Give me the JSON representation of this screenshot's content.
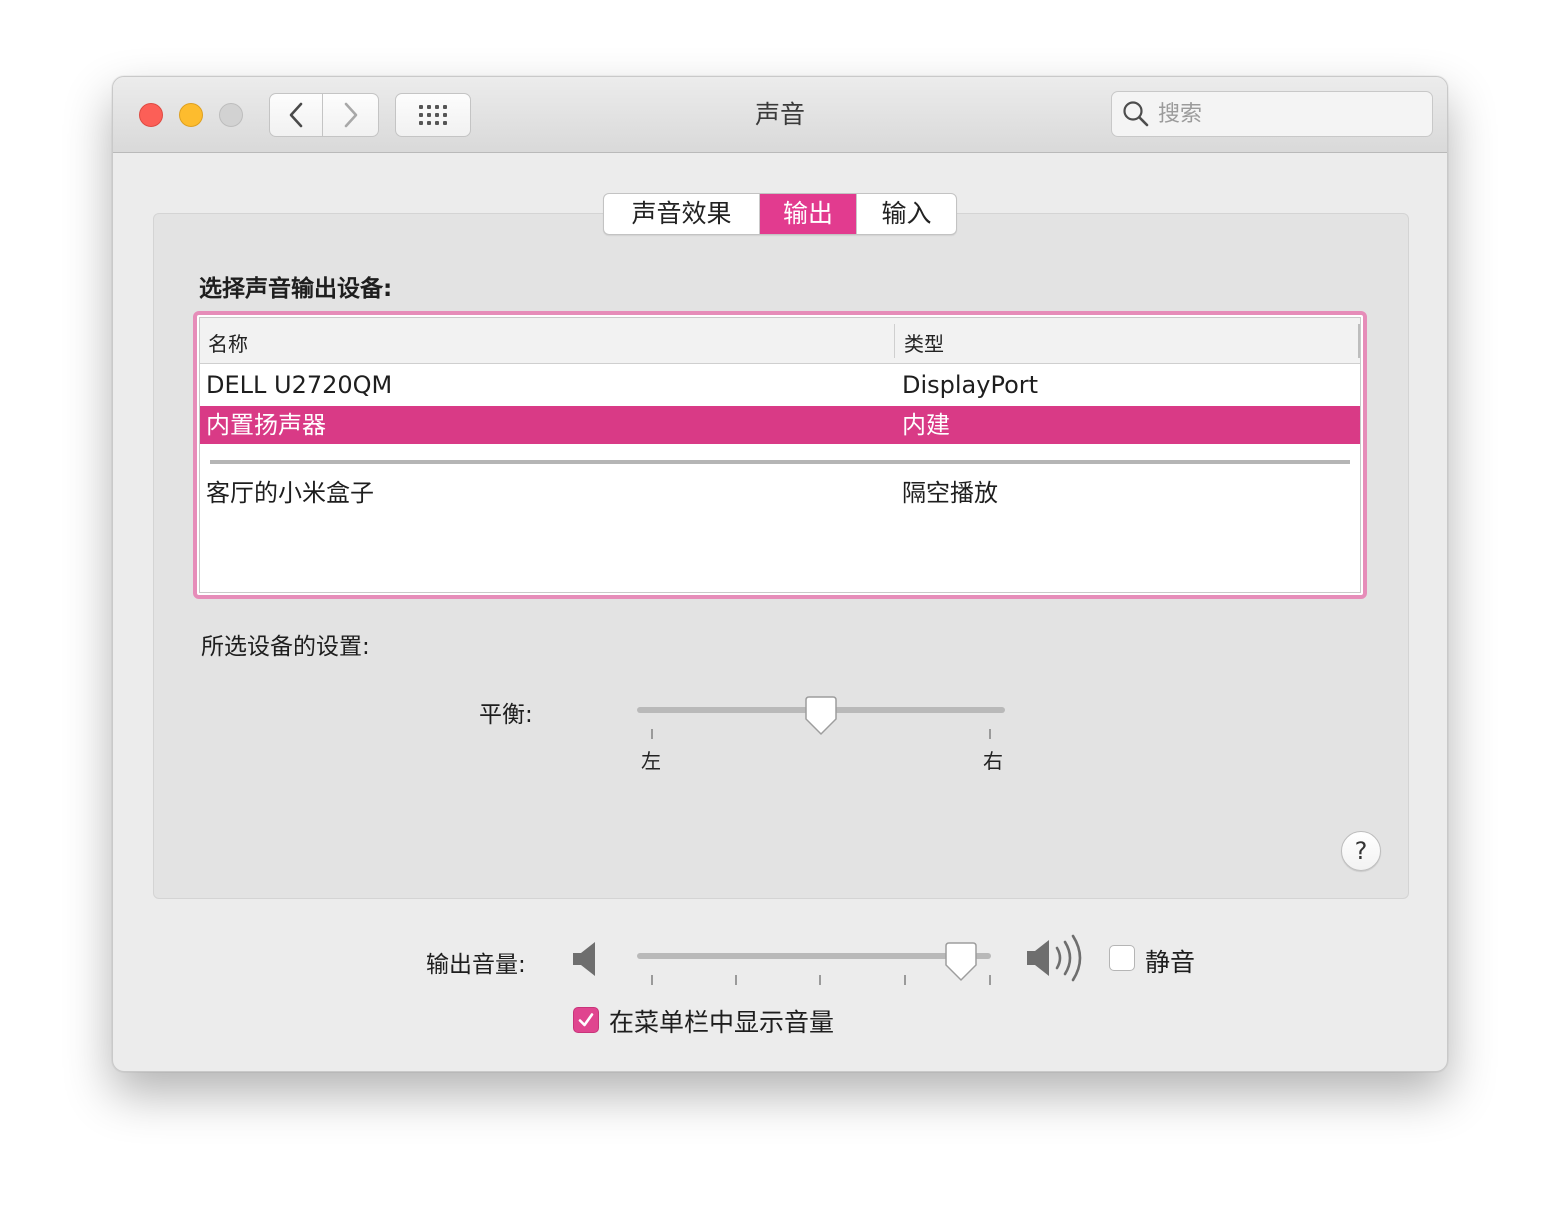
{
  "window": {
    "title": "声音",
    "search_placeholder": "搜索"
  },
  "tabs": [
    {
      "label": "声音效果",
      "selected": false
    },
    {
      "label": "输出",
      "selected": true
    },
    {
      "label": "输入",
      "selected": false
    }
  ],
  "output": {
    "select_label": "选择声音输出设备:",
    "columns": {
      "name": "名称",
      "type": "类型"
    },
    "devices": [
      {
        "name": "DELL U2720QM",
        "type": "DisplayPort",
        "selected": false
      },
      {
        "name": "内置扬声器",
        "type": "内建",
        "selected": true
      },
      {
        "name": "客厅的小米盒子",
        "type": "隔空播放",
        "selected": false
      }
    ],
    "settings_label": "所选设备的设置:",
    "balance": {
      "label": "平衡:",
      "left_label": "左",
      "right_label": "右",
      "value": 0.5
    }
  },
  "volume": {
    "label": "输出音量:",
    "value": 0.95,
    "mute_label": "静音",
    "mute_checked": false,
    "menubar_label": "在菜单栏中显示音量",
    "menubar_checked": true
  },
  "help": {
    "label": "?"
  },
  "colors": {
    "accent": "#e23b8f",
    "selected_row": "#d93a86",
    "focus_ring": "#e68db9"
  }
}
